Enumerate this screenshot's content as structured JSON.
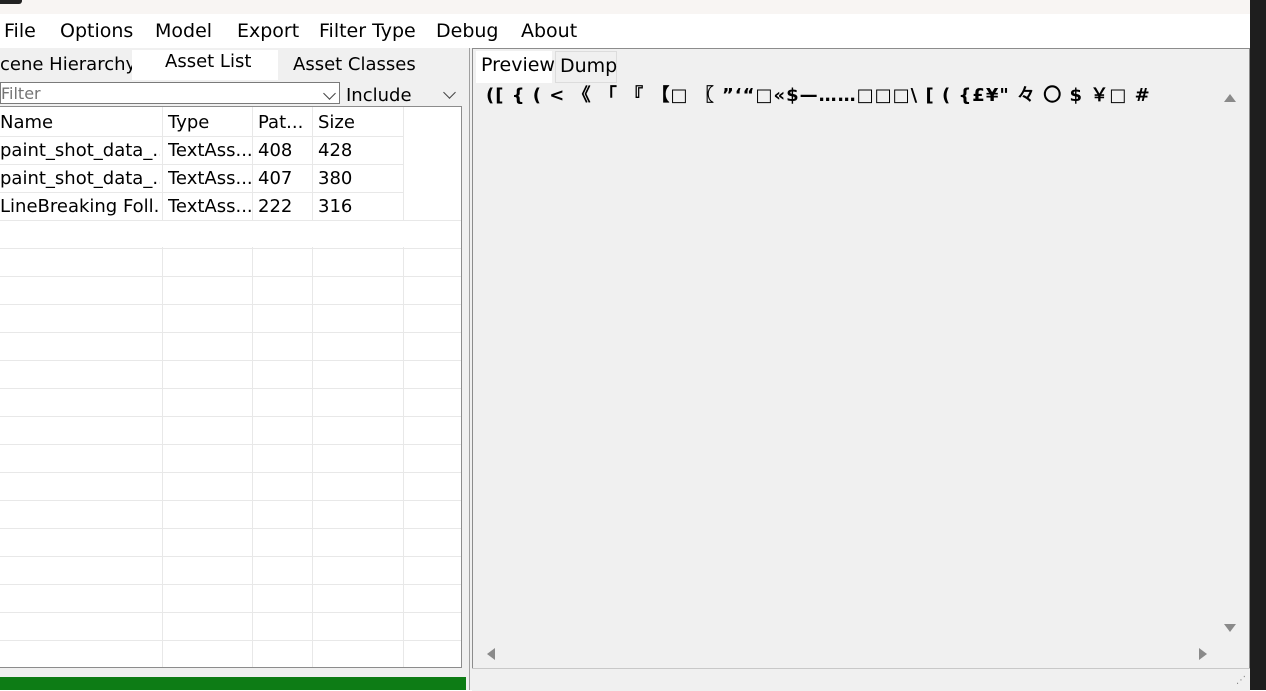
{
  "menu": [
    "File",
    "Options",
    "Model",
    "Export",
    "Filter Type",
    "Debug",
    "About"
  ],
  "left_tabs": {
    "scene_hierarchy": "cene Hierarchy",
    "asset_list": "Asset List",
    "asset_classes": "Asset Classes"
  },
  "filter": {
    "placeholder": "Filter",
    "value": ""
  },
  "include": {
    "selected": "Include"
  },
  "table": {
    "headers": [
      "Name",
      "Type",
      "Pat...",
      "Size"
    ],
    "rows": [
      {
        "name": "paint_shot_data_...",
        "type": "TextAss...",
        "path": "408",
        "size": "428"
      },
      {
        "name": "paint_shot_data_...",
        "type": "TextAss...",
        "path": "407",
        "size": "380"
      },
      {
        "name": "LineBreaking Foll...",
        "type": "TextAss...",
        "path": "222",
        "size": "316"
      }
    ]
  },
  "right_tabs": {
    "preview": "Preview",
    "dump": "Dump"
  },
  "preview_text": "([ { ( < 《 「 『 【□ 〖 ”‘“□«$—……□□□\\ [ ( {£¥\" 々 〇 $ ￥□ #",
  "colors": {
    "progress": "#0d7c15",
    "panel_bg": "#f0f0f0"
  },
  "icons": [
    "chevron-down-icon",
    "scroll-up-icon",
    "scroll-down-icon",
    "scroll-left-icon",
    "scroll-right-icon",
    "resize-grip-icon"
  ]
}
